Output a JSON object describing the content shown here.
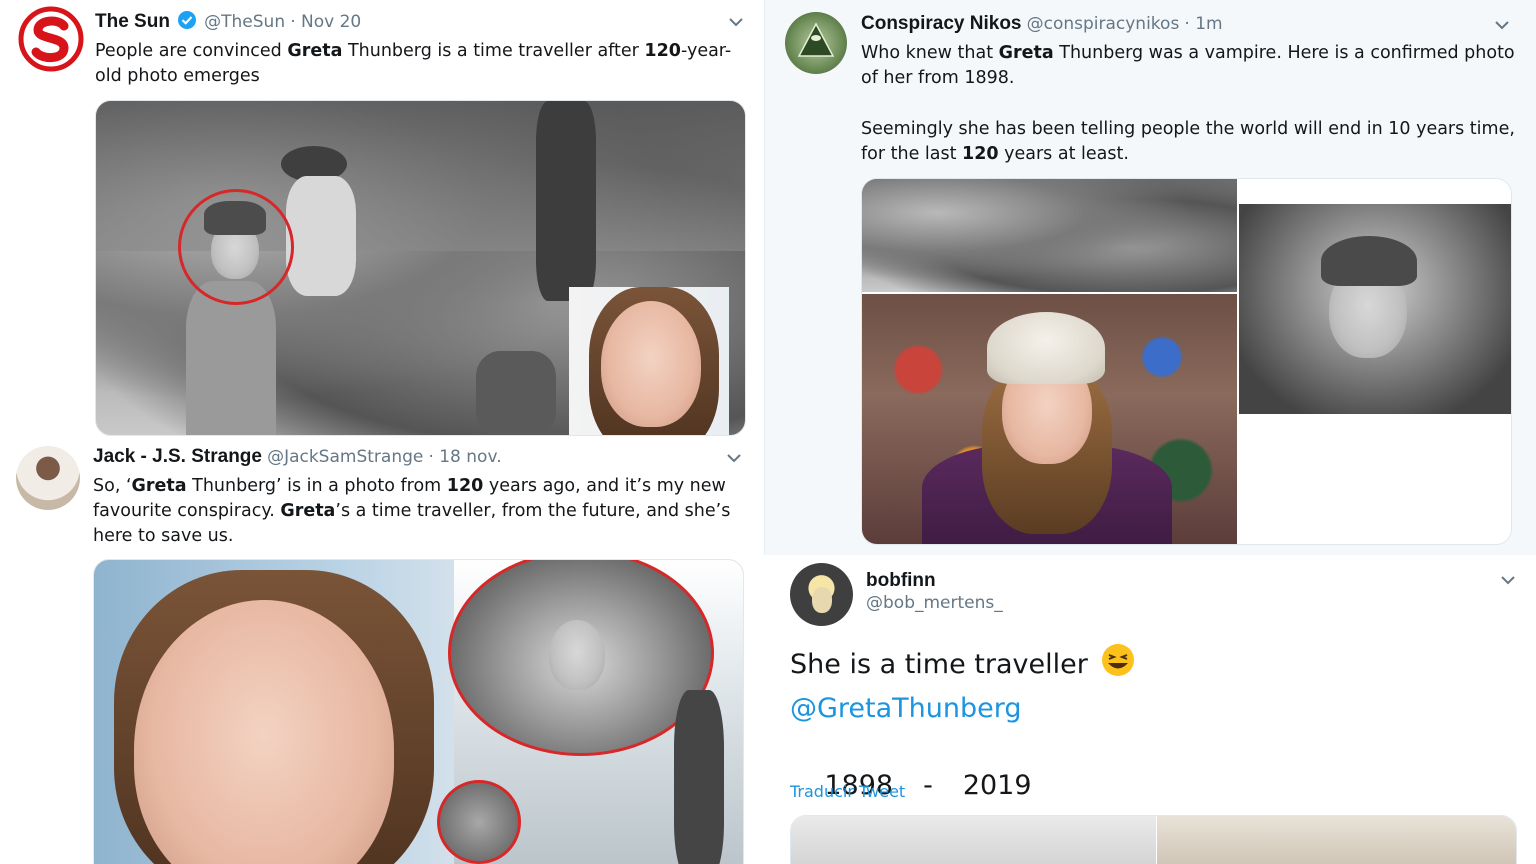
{
  "tweets": {
    "sun": {
      "name": "The Sun",
      "handle": "@TheSun",
      "date": "· Nov 20",
      "text_parts": [
        "People are convinced ",
        "Greta",
        " Thunberg is a time traveller after ",
        "120",
        "-year-old photo emerges"
      ]
    },
    "jack": {
      "name": "Jack - J.S. Strange",
      "handle": "@JackSamStrange",
      "date": "· 18 nov.",
      "text_parts": [
        "So, ‘",
        "Greta",
        " Thunberg’ is in a photo from ",
        "120",
        " years ago, and it’s my new favourite conspiracy. ",
        "Greta",
        "’s a time traveller, from the future, and she’s here to save us."
      ]
    },
    "nikos": {
      "name": "Conspiracy Nikos",
      "handle": "@conspiracynikos",
      "date": "· 1m",
      "para1_parts": [
        "Who knew that ",
        "Greta",
        " Thunberg was a vampire. Here is a confirmed photo of her from 1898."
      ],
      "para2_parts": [
        "Seemingly she has been telling people the world will end in 10 years time, for the last ",
        "120",
        " years at least."
      ]
    },
    "bob": {
      "name": "bobfinn",
      "handle": "@bob_mertens_",
      "line1": "She is a time traveller",
      "emoji": "😆",
      "mention": "@GretaThunberg",
      "year_from": "1898",
      "dash": "-",
      "year_to": "2019",
      "translate": "Traducir Tweet"
    }
  },
  "colors": {
    "link": "#1b95e0",
    "verified": "#1da1f2",
    "circle": "#d62828",
    "sun_red": "#d7141a"
  },
  "icons": [
    "verified-badge-icon",
    "chevron-down-icon"
  ]
}
